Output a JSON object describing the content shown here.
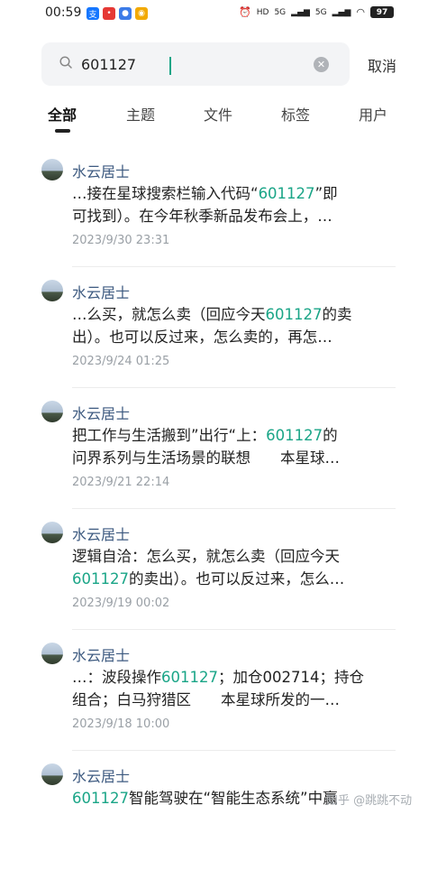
{
  "status": {
    "time": "00:59",
    "right_labels": [
      "HD",
      "5G",
      "5G"
    ],
    "battery": "97"
  },
  "search": {
    "value": "601127",
    "placeholder": "",
    "cancel_label": "取消"
  },
  "tabs": [
    {
      "label": "全部",
      "active": true
    },
    {
      "label": "主题",
      "active": false
    },
    {
      "label": "文件",
      "active": false
    },
    {
      "label": "标签",
      "active": false
    },
    {
      "label": "用户",
      "active": false
    }
  ],
  "results": [
    {
      "author": "水云居士",
      "line1": [
        {
          "t": "…接在星球搜索栏输入代码“"
        },
        {
          "t": "601127",
          "hl": true
        },
        {
          "t": "”即"
        }
      ],
      "line2": [
        {
          "t": "可找到）。在今年秋季新品发布会上，…"
        }
      ],
      "date": "2023/9/30 23:31"
    },
    {
      "author": "水云居士",
      "line1": [
        {
          "t": "…么买，就怎么卖（回应今天"
        },
        {
          "t": "601127",
          "hl": true
        },
        {
          "t": "的卖"
        }
      ],
      "line2": [
        {
          "t": "出）。也可以反过来，怎么卖的，再怎…"
        }
      ],
      "date": "2023/9/24 01:25"
    },
    {
      "author": "水云居士",
      "line1": [
        {
          "t": "把工作与生活搬到”出行“上："
        },
        {
          "t": "601127",
          "hl": true
        },
        {
          "t": "的"
        }
      ],
      "line2": [
        {
          "t": "问界系列与生活场景的联想　　本星球…"
        }
      ],
      "date": "2023/9/21 22:14"
    },
    {
      "author": "水云居士",
      "line1": [
        {
          "t": "逻辑自洽：怎么买，就怎么卖（回应今天"
        }
      ],
      "line2": [
        {
          "t": "601127",
          "hl": true
        },
        {
          "t": "的卖出）。也可以反过来，怎么…"
        }
      ],
      "date": "2023/9/19 00:02"
    },
    {
      "author": "水云居士",
      "line1": [
        {
          "t": "…：波段操作"
        },
        {
          "t": "601127",
          "hl": true
        },
        {
          "t": "；加仓002714；持仓"
        }
      ],
      "line2": [
        {
          "t": "组合；白马狩猎区　　本星球所发的一…"
        }
      ],
      "date": "2023/9/18 10:00"
    },
    {
      "author": "水云居士",
      "line1": [
        {
          "t": "601127",
          "hl": true
        },
        {
          "t": "智能驾驶在“智能生态系统”中赢"
        }
      ],
      "line2": [],
      "date": ""
    }
  ],
  "watermark": "知乎 @跳跳不动",
  "colors": {
    "highlight": "#1aa587",
    "author": "#3d5a80"
  }
}
